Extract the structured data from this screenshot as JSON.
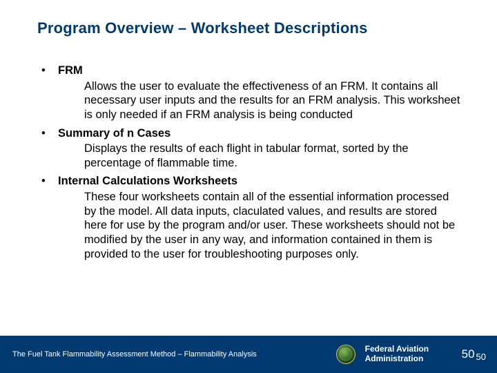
{
  "title": "Program Overview – Worksheet Descriptions",
  "bullets": [
    {
      "heading": "FRM",
      "body": "Allows the user to evaluate the effectiveness of an FRM.  It contains all necessary user inputs and the results for an FRM analysis.  This worksheet is only needed if an FRM analysis is being conducted"
    },
    {
      "heading": "Summary of n Cases",
      "body": "Displays the results of each flight in tabular format, sorted by the percentage of flammable time."
    },
    {
      "heading": "Internal Calculations Worksheets",
      "body": "These four worksheets contain all of the essential information processed by the model.  All data inputs, claculated values, and results are stored here for use by the program and/or user.  These worksheets should not be modified by the user in any way, and information contained in them is provided to the user for troubleshooting purposes only."
    }
  ],
  "footer": {
    "title": "The Fuel Tank Flammability Assessment Method – Flammability Analysis",
    "agency_line1": "Federal Aviation",
    "agency_line2": "Administration",
    "page": "50",
    "page_sub": "50"
  }
}
